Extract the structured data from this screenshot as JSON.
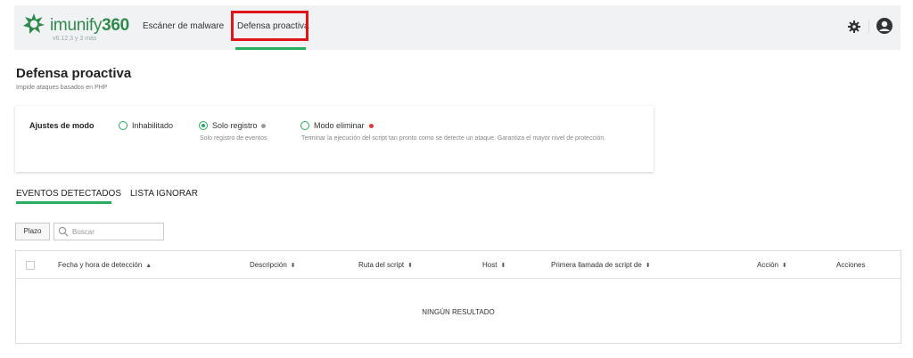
{
  "header": {
    "brand": "imunify360",
    "version": "v6.12.3 y 3 más",
    "nav": {
      "malware": "Escáner de malware",
      "proactive": "Defensa proactiva"
    },
    "icons": {
      "settings": "gear-icon",
      "user": "user-avatar-icon"
    },
    "accent_color": "#27ae60",
    "highlight_color": "#e0141b"
  },
  "page": {
    "title": "Defensa proactiva",
    "subtitle": "Impide ataques basados en PHP"
  },
  "mode_settings": {
    "label": "Ajustes de modo",
    "selected": "Solo registro",
    "options": [
      {
        "label": "Inhabilitado",
        "checked": false,
        "description": ""
      },
      {
        "label": "Solo registro",
        "checked": true,
        "description": "Solo registro de eventos",
        "dot_color": "#999999"
      },
      {
        "label": "Modo eliminar",
        "checked": false,
        "description": "Terminar la ejecución del script tan pronto como se detecte un ataque. Garantiza el mayor nivel de protección.",
        "dot_color": "#e53935"
      }
    ]
  },
  "tabs": [
    {
      "label": "EVENTOS DETECTADOS",
      "active": true
    },
    {
      "label": "LISTA IGNORAR",
      "active": false
    }
  ],
  "toolbar": {
    "period_button": "Plazo",
    "search_placeholder": "Buscar"
  },
  "table": {
    "columns": [
      {
        "label": "Fecha y hora de detección",
        "sort": "▲"
      },
      {
        "label": "Descripción",
        "sort": "⬍"
      },
      {
        "label": "Ruta del script",
        "sort": "⬍"
      },
      {
        "label": "Host",
        "sort": "⬍"
      },
      {
        "label": "Primera llamada de script de",
        "sort": "⬍"
      },
      {
        "label": "Acción",
        "sort": "⬍"
      },
      {
        "label": "Acciones",
        "sort": ""
      }
    ],
    "empty_text": "NINGÚN RESULTADO"
  }
}
